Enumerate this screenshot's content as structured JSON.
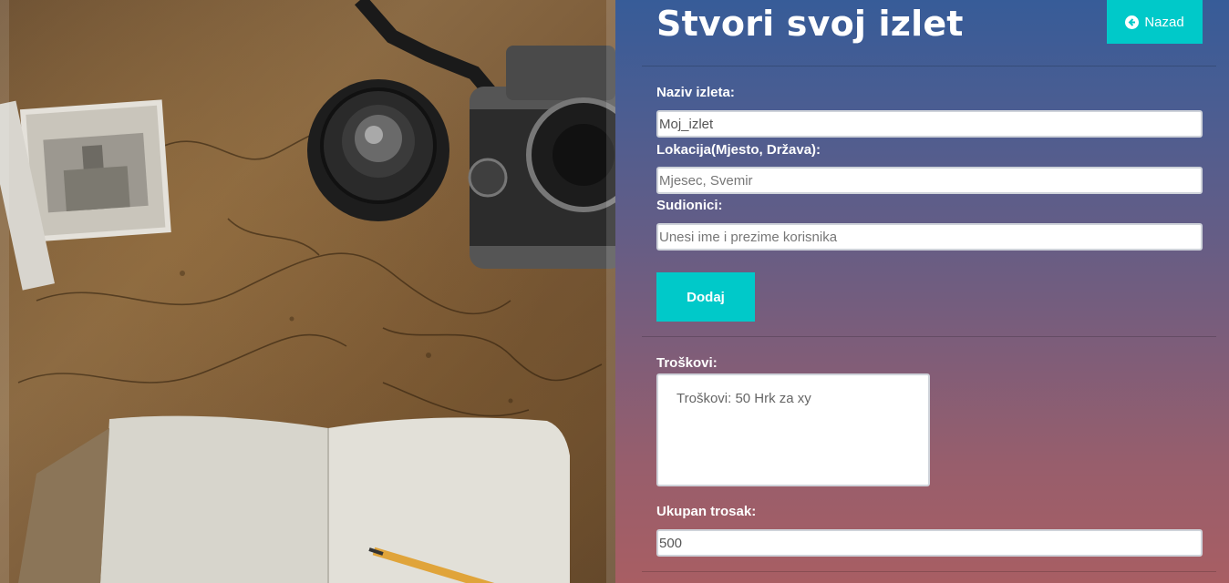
{
  "page": {
    "title": "Stvori svoj izlet",
    "back_label": "Nazad",
    "back_icon": "arrow-circle-left-icon"
  },
  "form": {
    "trip_name_label": "Naziv izleta:",
    "trip_name_value": "Moj_izlet",
    "location_label": "Lokacija(Mjesto, Država):",
    "location_placeholder": "Mjesec, Svemir",
    "participants_label": "Sudionici:",
    "participants_placeholder": "Unesi ime i prezime korisnika",
    "add_label": "Dodaj",
    "costs_label": "Troškovi:",
    "costs_value": "Troškovi: 50 Hrk za xy",
    "total_label": "Ukupan trosak:",
    "total_value": "500"
  },
  "colors": {
    "accent": "#00c9c9",
    "gradient_top": "#375c98",
    "gradient_bottom": "#a85e63"
  }
}
